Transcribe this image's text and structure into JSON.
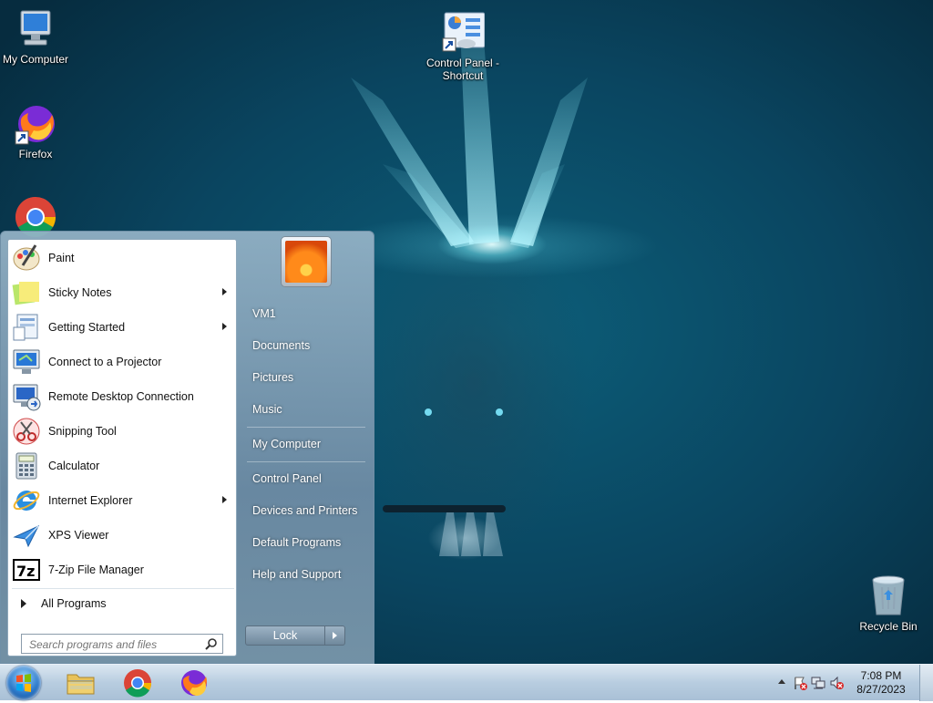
{
  "desktop": {
    "icons": [
      {
        "label": "My Computer"
      },
      {
        "label": "Firefox"
      },
      {
        "label": "Control Panel - Shortcut"
      },
      {
        "label": "Recycle Bin"
      }
    ]
  },
  "start_menu": {
    "programs": [
      {
        "label": "Paint",
        "has_submenu": false
      },
      {
        "label": "Sticky Notes",
        "has_submenu": true
      },
      {
        "label": "Getting Started",
        "has_submenu": true
      },
      {
        "label": "Connect to a Projector",
        "has_submenu": false
      },
      {
        "label": "Remote Desktop Connection",
        "has_submenu": false
      },
      {
        "label": "Snipping Tool",
        "has_submenu": false
      },
      {
        "label": "Calculator",
        "has_submenu": false
      },
      {
        "label": "Internet Explorer",
        "has_submenu": true
      },
      {
        "label": "XPS Viewer",
        "has_submenu": false
      },
      {
        "label": "7-Zip File Manager",
        "has_submenu": false
      }
    ],
    "all_programs": "All Programs",
    "search_placeholder": "Search programs and files",
    "right_items": {
      "user": "VM1",
      "documents": "Documents",
      "pictures": "Pictures",
      "music": "Music",
      "computer": "My Computer",
      "control_panel": "Control Panel",
      "devices": "Devices and Printers",
      "default_programs": "Default Programs",
      "help": "Help and Support"
    },
    "lock_label": "Lock"
  },
  "taskbar": {
    "clock_time": "7:08 PM",
    "clock_date": "8/27/2023"
  },
  "colors": {
    "desktop_bg": "#0a4560",
    "taskbar_bg": "#b8cde0",
    "accent": "#2b78c9"
  }
}
